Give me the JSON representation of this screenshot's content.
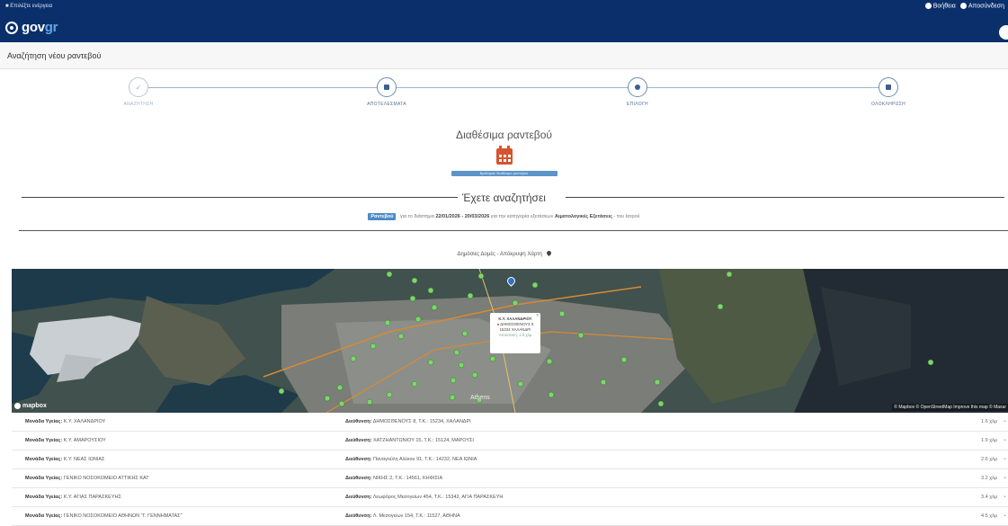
{
  "topbar": {
    "user_text": "Επιλέξτε ενέργεια",
    "logo_prefix": "gov",
    "logo_suffix": "gr",
    "help_label": "Βοήθεια",
    "logout_label": "Αποσύνδεση",
    "brand_color": "#0a2f6b"
  },
  "page": {
    "title": "Αναζήτηση νέου ραντεβού"
  },
  "stepper": {
    "steps": [
      {
        "label": "ΑΝΑΖΗΤΗΣΗ",
        "state": "done",
        "icon": "check-icon"
      },
      {
        "label": "ΑΠΟΤΕΛΕΣΜΑΤΑ",
        "state": "active",
        "icon": "list-icon"
      },
      {
        "label": "ΕΠΙΛΟΓΗ",
        "state": "pending",
        "icon": "dot-icon"
      },
      {
        "label": "ΟΛΟΚΛΗΡΩΣΗ",
        "state": "pending",
        "icon": "save-icon"
      }
    ]
  },
  "results": {
    "title": "Διαθέσιμα ραντεβού",
    "badge_text": "Βρέθηκαν διαθέσιμα ραντεβού"
  },
  "search_summary": {
    "heading": "Έχετε αναζητήσει",
    "type_badge": "Ραντεβού",
    "text_prefix": "για το διάστημα",
    "date_range": "22/01/2026 - 20/03/2026",
    "text_mid": "για την κατηγορία εξετάσεων",
    "category": "Αιματολογικές Εξετάσεις",
    "text_suffix": "- του Ιατρού"
  },
  "map": {
    "toggle_label": "Δημόσιες Δομές - Απόκρυψη Χάρτη",
    "mapbox_label": "mapbox",
    "attribution": "© Mapbox © OpenStreetMap Improve this map © Maxar",
    "city_label": "Athens",
    "popup": {
      "name": "Κ.Υ. ΧΑΛΑΝΔΡΙΟΥ",
      "line1": "ΔΗΜΟΣΘΕΝΟΥΣ 8",
      "line2": "15234 ΧΑΛΑΝΔΡΙ",
      "distance": "Απόσταση: 1.6 χλμ",
      "close": "×"
    }
  },
  "facilities": [
    {
      "unit_label": "Μονάδα Υγείας:",
      "unit": "Κ.Υ. ΧΑΛΑΝΔΡΙΟΥ",
      "addr_label": "Διεύθυνση:",
      "address": "ΔΗΜΟΣΘΕΝΟΥΣ 8, Τ.Κ.: 15234, ΧΑΛΑΝΔΡΙ",
      "distance": "1.6 χλμ"
    },
    {
      "unit_label": "Μονάδα Υγείας:",
      "unit": "Κ.Υ. ΑΜΑΡΟΥΣΙΟΥ",
      "addr_label": "Διεύθυνση:",
      "address": "ΧΑΤΖΗΑΝΤΩΝΙΟΥ 15, Τ.Κ.: 15124, ΜΑΡΟΥΣΙ",
      "distance": "1.9 χλμ"
    },
    {
      "unit_label": "Μονάδα Υγείας:",
      "unit": "Κ.Υ. ΝΕΑΣ ΙΩΝΙΑΣ",
      "addr_label": "Διεύθυνση:",
      "address": "Παναγούλη Αλέκου 91, Τ.Κ.: 14232, ΝΕΑ ΙΩΝΙΑ",
      "distance": "2.6 χλμ"
    },
    {
      "unit_label": "Μονάδα Υγείας:",
      "unit": "ΓΕΝΙΚΟ ΝΟΣΟΚΟΜΕΙΟ ΑΤΤΙΚΗΣ ΚΑΤ",
      "addr_label": "Διεύθυνση:",
      "address": "ΝΙΚΗΣ 2, Τ.Κ.: 14561, ΚΗΦΙΣΙΑ",
      "distance": "3.2 χλμ"
    },
    {
      "unit_label": "Μονάδα Υγείας:",
      "unit": "Κ.Υ. ΑΓΙΑΣ ΠΑΡΑΣΚΕΥΗΣ",
      "addr_label": "Διεύθυνση:",
      "address": "Λεωφόρος Μεσογείων 454, Τ.Κ.: 15342, ΑΓΙΑ ΠΑΡΑΣΚΕΥΗ",
      "distance": "3.4 χλμ"
    },
    {
      "unit_label": "Μονάδα Υγείας:",
      "unit": "ΓΕΝΙΚΟ ΝΟΣΟΚΟΜΕΙΟ ΑΘΗΝΩΝ \"Γ. ΓΕΝΝΗΜΑΤΑΣ\"",
      "addr_label": "Διεύθυνση:",
      "address": "Λ. Μεσογείων 154, Τ.Κ.: 11527, ΑΘΗΝΑ",
      "distance": "4.5 χλμ"
    }
  ]
}
